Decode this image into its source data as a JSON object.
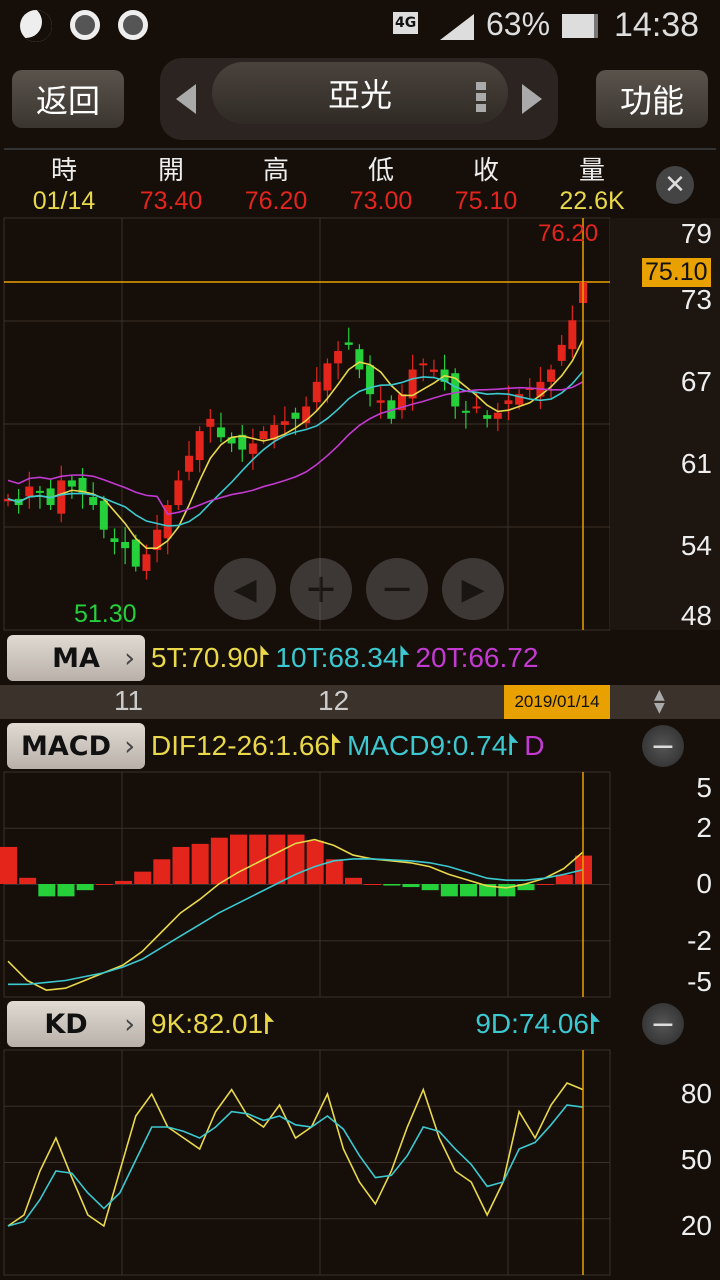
{
  "status_bar": {
    "icons": [
      "moon-icon",
      "chrome-icon",
      "chrome-icon"
    ],
    "network": "4G",
    "battery": "63%",
    "time": "14:38"
  },
  "toolbar": {
    "back_label": "返回",
    "stock_name": "亞光",
    "function_label": "功能"
  },
  "quote_header": {
    "labels": [
      "時",
      "開",
      "高",
      "低",
      "收",
      "量"
    ],
    "values": [
      "01/14",
      "73.40",
      "76.20",
      "73.00",
      "75.10",
      "22.6K"
    ]
  },
  "price_chart": {
    "high_marker": "76.20",
    "low_marker": "51.30",
    "current_price": "75.10",
    "y_ticks": [
      "79",
      "73",
      "67",
      "61",
      "54",
      "48"
    ]
  },
  "ma_row": {
    "button": "MA",
    "items": [
      {
        "text": "5T:70.90",
        "color": "#e8d84a"
      },
      {
        "text": "10T:68.34",
        "color": "#3cc8d0"
      },
      {
        "text": "20T:66.72",
        "color": "#c23ad0"
      }
    ]
  },
  "date_axis": {
    "labels": [
      "11",
      "12"
    ],
    "selected_date": "2019/01/14"
  },
  "macd_row": {
    "button": "MACD",
    "items": [
      {
        "text": "DIF12-26:1.66",
        "color": "#e8d84a"
      },
      {
        "text": "MACD9:0.74",
        "color": "#3cc8d0"
      },
      {
        "text": "D",
        "color": "#c23ad0"
      }
    ],
    "y_ticks": [
      "5",
      "2",
      "0",
      "-2",
      "-5"
    ]
  },
  "kd_row": {
    "button": "KD",
    "k": "9K:82.01",
    "d": "9D:74.06",
    "y_ticks": [
      "80",
      "50",
      "20"
    ]
  },
  "chart_data": {
    "type": "candlestick",
    "price_range": [
      48,
      79
    ],
    "closes": [
      57.5,
      57,
      58.5,
      58,
      57,
      59,
      58.5,
      58,
      57,
      55,
      54,
      53.5,
      52,
      53,
      55,
      57,
      59,
      61,
      63,
      64,
      62.5,
      62,
      61.5,
      62,
      63,
      63.5,
      63.8,
      64,
      65,
      67,
      68.5,
      69.5,
      70,
      68,
      66,
      65.5,
      64,
      66,
      68,
      68.5,
      68,
      67,
      65,
      64.5,
      65,
      64,
      64.5,
      65.5,
      66,
      66.5,
      67,
      68,
      70,
      72,
      75.1
    ],
    "last_candle": {
      "open": 73.4,
      "high": 76.2,
      "low": 73.0,
      "close": 75.1
    },
    "macd": {
      "dif": [
        -4,
        -5,
        -5.5,
        -5.4,
        -5,
        -4.6,
        -4.2,
        -3.5,
        -2.5,
        -1.5,
        -0.8,
        0,
        0.6,
        1.1,
        1.6,
        2.1,
        2.3,
        2.0,
        1.5,
        1.3,
        1.2,
        1.1,
        0.9,
        0.5,
        0.2,
        -0.1,
        -0.2,
        0,
        0.3,
        0.8,
        1.66
      ],
      "signal": [
        -5.2,
        -5.2,
        -5.1,
        -5.0,
        -4.8,
        -4.6,
        -4.3,
        -3.9,
        -3.3,
        -2.7,
        -2.1,
        -1.5,
        -1,
        -0.5,
        0,
        0.5,
        0.9,
        1.2,
        1.3,
        1.3,
        1.25,
        1.2,
        1.1,
        0.9,
        0.6,
        0.3,
        0.2,
        0.2,
        0.3,
        0.5,
        0.74
      ]
    },
    "kd": {
      "k": [
        20,
        25,
        45,
        60,
        42,
        25,
        20,
        45,
        70,
        80,
        65,
        60,
        55,
        72,
        82,
        70,
        65,
        75,
        60,
        65,
        80,
        55,
        40,
        30,
        45,
        65,
        82,
        60,
        45,
        40,
        25,
        40,
        72,
        60,
        75,
        85,
        82
      ],
      "d": [
        20,
        22,
        32,
        45,
        44,
        35,
        28,
        35,
        50,
        65,
        65,
        63,
        60,
        65,
        72,
        71,
        68,
        70,
        66,
        65,
        70,
        64,
        52,
        42,
        43,
        52,
        65,
        63,
        55,
        48,
        38,
        40,
        55,
        58,
        66,
        75,
        74
      ]
    }
  }
}
